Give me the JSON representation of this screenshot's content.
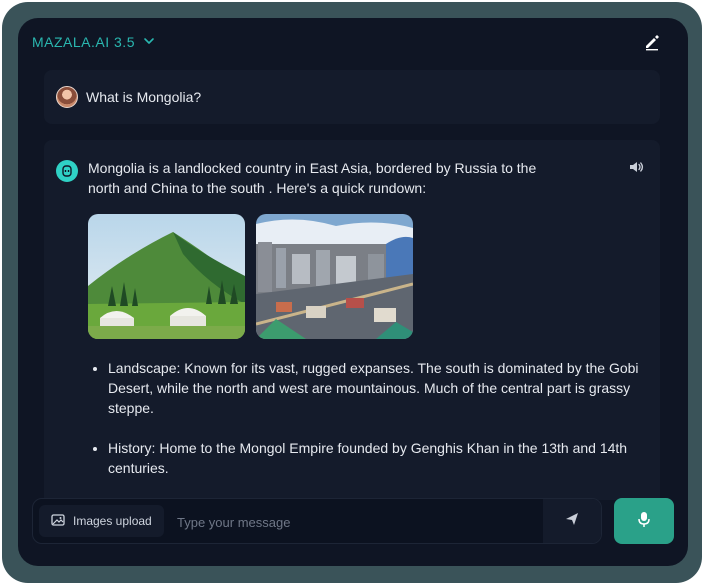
{
  "header": {
    "model_label": "MAZALA.AI 3.5",
    "chevron_icon": "chevron-down-icon",
    "edit_icon": "edit-pencil-icon"
  },
  "user_message": {
    "text": "What is Mongolia?",
    "avatar_icon": "user-avatar"
  },
  "assistant_message": {
    "icon": "bot-icon",
    "intro": "Mongolia is a landlocked country in East Asia, bordered by Russia to the north and China to the south . Here's a quick rundown:",
    "speaker_icon": "speaker-icon",
    "images": [
      "mountain-yurts-landscape",
      "ulaanbaatar-city-skyline"
    ],
    "bullets": [
      "Landscape: Known for its vast, rugged expanses. The south is dominated by the Gobi Desert, while the north and west are mountainous. Much of the central part is grassy steppe.",
      "History: Home to the Mongol Empire founded by Genghis Khan in the 13th and 14th centuries."
    ]
  },
  "composer": {
    "upload_label": "Images upload",
    "upload_icon": "image-icon",
    "placeholder": "Type your message",
    "send_icon": "send-icon",
    "mic_icon": "microphone-icon"
  },
  "colors": {
    "accent": "#2ab7b0",
    "mic_button": "#2aa189",
    "panel_bg": "#0f1524",
    "frame": "#3a5359"
  }
}
